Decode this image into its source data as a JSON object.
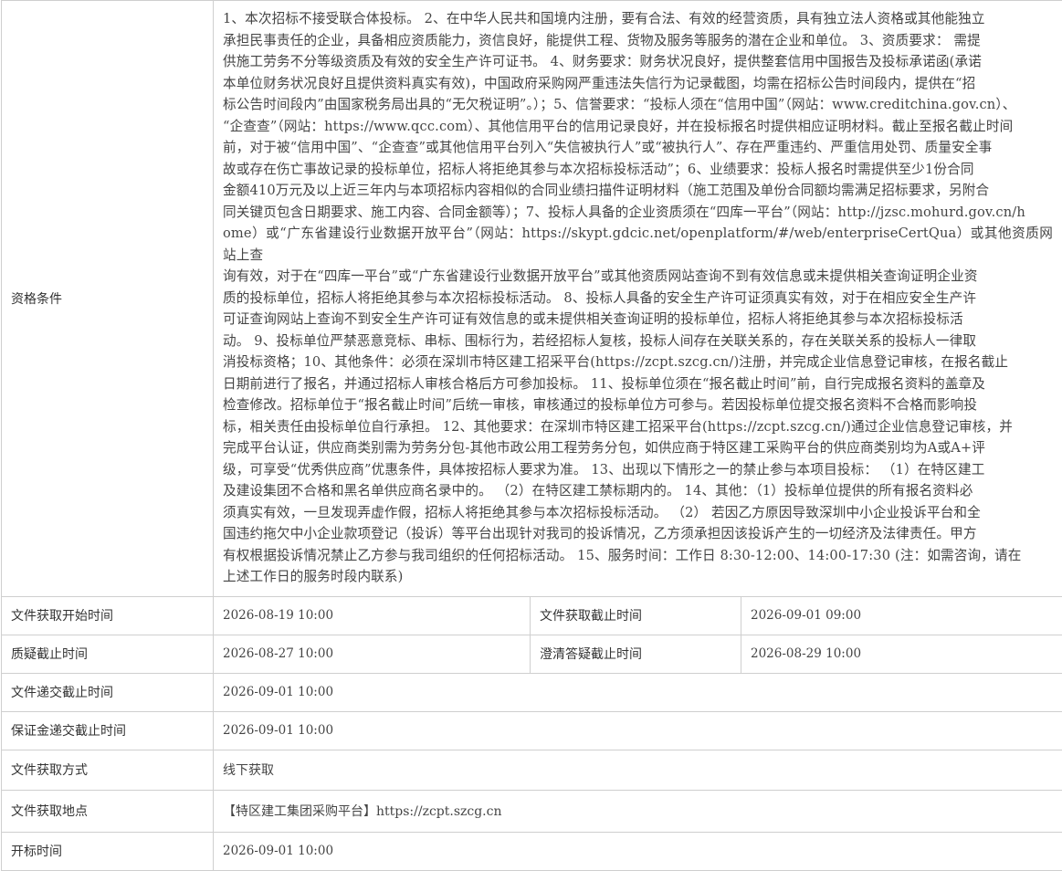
{
  "qualification": {
    "label": "资格条件",
    "lines": [
      "1、本次招标不接受联合体投标。 2、在中华人民共和国境内注册，要有合法、有效的经营资质，具有独立法人资格或其他能独立",
      "承担民事责任的企业，具备相应资质能力，资信良好，能提供工程、货物及服务等服务的潜在企业和单位。 3、资质要求： 需提",
      "供施工劳务不分等级资质及有效的安全生产许可证书。 4、财务要求：财务状况良好，提供整套信用中国报告及投标承诺函(承诺",
      "本单位财务状况良好且提供资料真实有效)，中国政府采购网严重违法失信行为记录截图，均需在招标公告时间段内，提供在“招",
      "标公告时间段内”由国家税务局出具的“无欠税证明”。）；5、信誉要求：“投标人须在“信用中国”（网站：www.creditchina.gov.cn）、",
      "“企查查”（网站：https://www.qcc.com）、其他信用平台的信用记录良好，并在投标报名时提供相应证明材料。截止至报名截止时间",
      "前，对于被“信用中国”、“企查查”或其他信用平台列入“失信被执行人”或“被执行人”、存在严重违约、严重信用处罚、质量安全事",
      "故或存在伤亡事故记录的投标单位，招标人将拒绝其参与本次招标投标活动”；6、业绩要求：投标人报名时需提供至少1份合同",
      "金额410万元及以上近三年内与本项招标内容相似的合同业绩扫描件证明材料（施工范围及单份合同额均需满足招标要求，另附合",
      "同关键页包含日期要求、施工内容、合同金额等）；7、投标人具备的企业资质须在“四库一平台”（网站：http://jzsc.mohurd.gov.cn/h",
      "ome）或“广东省建设行业数据开放平台”（网站：https://skypt.gdcic.net/openplatform/#/web/enterpriseCertQua）或其他资质网站上查",
      "询有效，对于在“四库一平台”或“广东省建设行业数据开放平台”或其他资质网站查询不到有效信息或未提供相关查询证明企业资",
      "质的投标单位，招标人将拒绝其参与本次招标投标活动。 8、投标人具备的安全生产许可证须真实有效，对于在相应安全生产许",
      "可证查询网站上查询不到安全生产许可证有效信息的或未提供相关查询证明的投标单位，招标人将拒绝其参与本次招标投标活",
      "动。 9、投标单位严禁恶意竞标、串标、围标行为，若经招标人复核，投标人间存在关联关系的，存在关联关系的投标人一律取",
      "消投标资格；10、其他条件：必须在深圳市特区建工招采平台(https://zcpt.szcg.cn/)注册，并完成企业信息登记审核，在报名截止",
      "日期前进行了报名，并通过招标人审核合格后方可参加投标。 11、投标单位须在“报名截止时间”前，自行完成报名资料的盖章及",
      "检查修改。招标单位于“报名截止时间”后统一审核，审核通过的投标单位方可参与。若因投标单位提交报名资料不合格而影响投",
      "标，相关责任由投标单位自行承担。 12、其他要求：在深圳市特区建工招采平台(https://zcpt.szcg.cn/)通过企业信息登记审核，并",
      "完成平台认证，供应商类别需为劳务分包-其他市政公用工程劳务分包，如供应商于特区建工采购平台的供应商类别均为A或A+评",
      "级，可享受“优秀供应商”优惠条件，具体按招标人要求为准。 13、出现以下情形之一的禁止参与本项目投标： （1）在特区建工",
      "及建设集团不合格和黑名单供应商名录中的。 （2）在特区建工禁标期内的。 14、其他：（1）投标单位提供的所有报名资料必",
      "须真实有效，一旦发现弄虚作假，招标人将拒绝其参与本次招标投标活动。 （2） 若因乙方原因导致深圳中小企业投诉平台和全",
      "国违约拖欠中小企业款项登记（投诉）等平台出现针对我司的投诉情况，乙方须承担因该投诉产生的一切经济及法律责任。甲方",
      "有权根据投诉情况禁止乙方参与我司组织的任何招标活动。 15、服务时间：工作日 8:30-12:00、14:00-17:30 (注：如需咨询，请在",
      "上述工作日的服务时段内联系)"
    ]
  },
  "rows": [
    {
      "label": "文件获取开始时间",
      "value": "2026-08-19 10:00",
      "label2": "文件获取截止时间",
      "value2": "2026-09-01 09:00"
    },
    {
      "label": "质疑截止时间",
      "value": "2026-08-27 10:00",
      "label2": "澄清答疑截止时间",
      "value2": "2026-08-29 10:00"
    },
    {
      "label": "文件递交截止时间",
      "value": "2026-09-01 10:00"
    },
    {
      "label": "保证金递交截止时间",
      "value": "2026-09-01 10:00"
    },
    {
      "label": "文件获取方式",
      "value": "线下获取"
    },
    {
      "label": "文件获取地点",
      "value": "【特区建工集团采购平台】https://zcpt.szcg.cn"
    },
    {
      "label": "开标时间",
      "value": "2026-09-01 10:00"
    }
  ]
}
